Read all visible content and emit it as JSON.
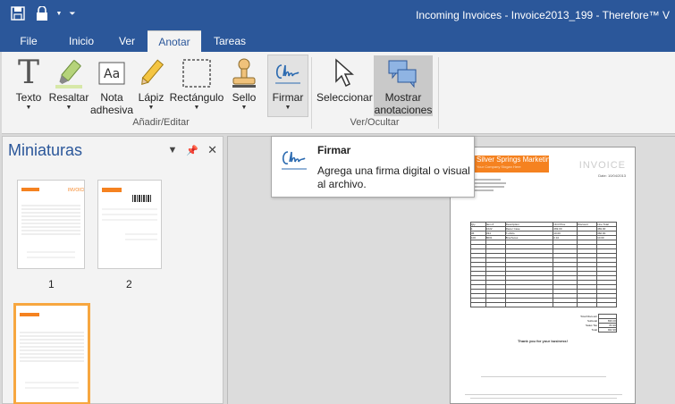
{
  "window": {
    "title": "Incoming Invoices - Invoice2013_199 - Therefore™ V"
  },
  "menu_tabs": [
    {
      "label": "File"
    },
    {
      "label": "Inicio"
    },
    {
      "label": "Ver"
    },
    {
      "label": "Anotar"
    },
    {
      "label": "Tareas"
    }
  ],
  "ribbon": {
    "buttons": {
      "texto": "Texto",
      "resaltar": "Resaltar",
      "nota_line1": "Nota",
      "nota_line2": "adhesiva",
      "lapiz": "Lápiz",
      "rectangulo": "Rectángulo",
      "sello": "Sello",
      "firmar": "Firmar",
      "seleccionar": "Seleccionar",
      "mostrar_line1": "Mostrar",
      "mostrar_line2": "anotaciones"
    },
    "groups": {
      "add_edit": "Añadir/Editar",
      "show_hide": "Ver/Ocultar"
    }
  },
  "left_pane": {
    "title": "Miniaturas",
    "thumbnails": [
      {
        "number": "1"
      },
      {
        "number": "2"
      }
    ]
  },
  "tooltip": {
    "title": "Firmar",
    "body": "Agrega una firma digital o visual al archivo."
  },
  "document": {
    "company": "Silver Springs Marketing",
    "tagline": "Your Company Slogan Here",
    "heading": "INVOICE",
    "date_label": "Date: 10/04/2013",
    "thank_you": "Thank you for your business!",
    "table_headers": [
      "Qty",
      "Item #",
      "Description",
      "Unit Price",
      "Discount",
      "Line Total"
    ],
    "rows": [
      [
        "1",
        "1022",
        "Racer Case",
        "469.00",
        "",
        "469.00"
      ],
      [
        "36",
        "334",
        "T-shirts",
        "10.00",
        "",
        "360.00"
      ],
      [
        "100",
        "8001",
        "Brochures",
        "0.10",
        "",
        "10.00"
      ]
    ],
    "totals": [
      {
        "label": "Total Discount",
        "value": ""
      },
      {
        "label": "Subtotal",
        "value": "839.00"
      },
      {
        "label": "Sales Tax",
        "value": "83.90"
      },
      {
        "label": "Total",
        "value": "922.90"
      }
    ]
  },
  "colors": {
    "title_bar": "#2b579a",
    "ribbon_bg": "#f3f3f3",
    "accent_orange": "#f58220",
    "selected_thumb_border": "#f7a740"
  }
}
